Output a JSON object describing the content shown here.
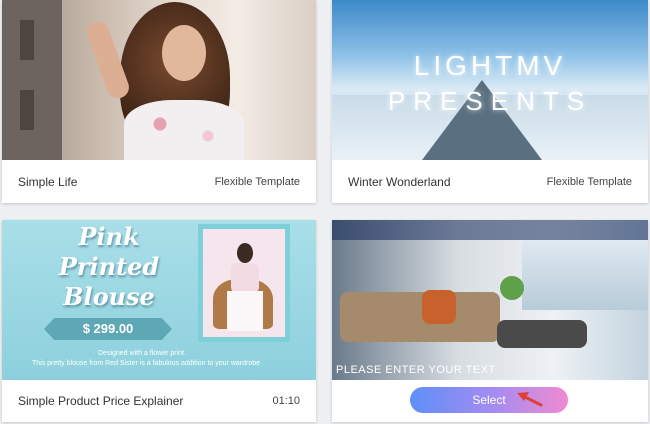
{
  "templates": [
    {
      "title": "Simple Life",
      "meta": "Flexible Template"
    },
    {
      "title": "Winter Wonderland",
      "meta": "Flexible Template",
      "overlay_line1": "LIGHTMV",
      "overlay_line2": "PRESENTS"
    },
    {
      "title": "Simple Product Price Explainer",
      "meta": "01:10",
      "overlay_line1": "Pink",
      "overlay_line2": "Printed",
      "overlay_line3": "Blouse",
      "price": "$ 299.00",
      "fine1": "Designed with a flower print.",
      "fine2": "This pretty blouse from Red Sister is a fabulous addition to your wardrobe"
    },
    {
      "overlay_text": "PLEASE ENTER YOUR TEXT",
      "select_label": "Select"
    }
  ],
  "colors": {
    "accent_gradient_start": "#5f8ef8",
    "accent_gradient_end": "#f08bd0",
    "arrow": "#e0403a"
  }
}
